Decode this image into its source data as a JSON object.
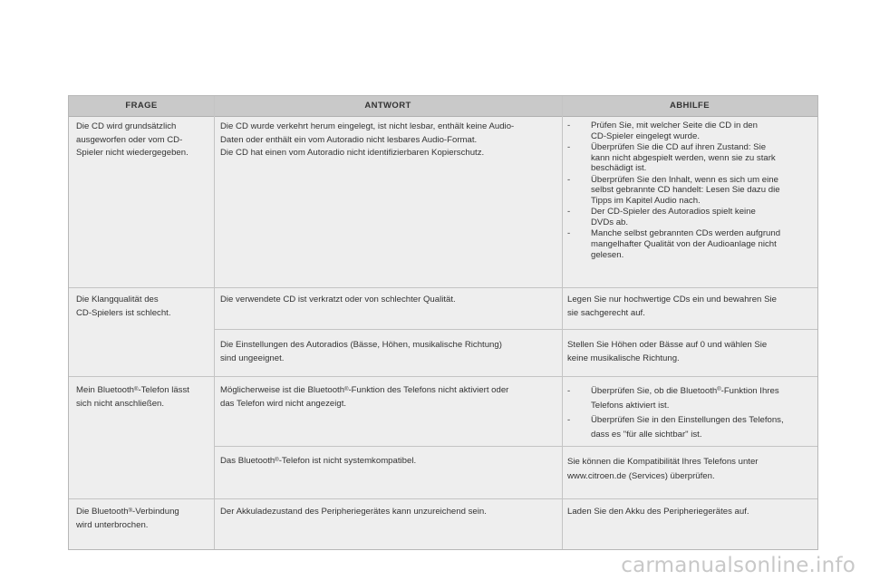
{
  "table": {
    "headers": [
      "FRAGE",
      "ANTWORT",
      "ABHILFE"
    ],
    "rows": [
      {
        "frage": [
          "Die CD wird grundsätzlich",
          "ausgeworfen oder vom CD-",
          "Spieler nicht wiedergegeben."
        ],
        "antwort": [
          "Die CD wurde verkehrt herum eingelegt, ist nicht lesbar, enthält keine Audio-",
          "Daten oder enthält ein vom Autoradio nicht lesbares Audio-Format.",
          "Die CD hat einen vom Autoradio nicht identifizierbaren Kopierschutz."
        ],
        "abhilfe": [
          {
            "dash": "-",
            "lines": [
              "Prüfen Sie, mit welcher Seite die CD in den",
              "CD-Spieler eingelegt wurde."
            ]
          },
          {
            "dash": "-",
            "lines": [
              "Überprüfen Sie die CD auf ihren Zustand: Sie",
              "kann nicht abgespielt werden, wenn sie zu stark",
              "beschädigt ist."
            ]
          },
          {
            "dash": "-",
            "lines": [
              "Überprüfen Sie den Inhalt, wenn es sich um eine",
              "selbst gebrannte CD handelt: Lesen Sie dazu die",
              "Tipps im Kapitel Audio nach."
            ]
          },
          {
            "dash": "-",
            "lines": [
              "Der CD-Spieler des Autoradios spielt keine",
              "DVDs ab."
            ]
          },
          {
            "dash": "-",
            "lines": [
              "Manche selbst gebrannten CDs werden aufgrund",
              "mangelhafter Qualität von der Audioanlage nicht",
              "gelesen."
            ]
          }
        ]
      },
      {
        "frage": [
          "Die Klangqualität des",
          "CD-Spielers ist schlecht."
        ],
        "antwort": [
          "Die verwendete CD ist verkratzt oder von schlechter Qualität."
        ],
        "abhilfe_text": [
          "Legen Sie nur hochwertige CDs ein und bewahren Sie",
          "sie sachgerecht auf."
        ]
      },
      {
        "antwort": [
          "Die Einstellungen des Autoradios (Bässe, Höhen, musikalische Richtung)",
          "sind ungeeignet."
        ],
        "abhilfe_text": [
          "Stellen Sie Höhen oder Bässe auf 0 und wählen Sie",
          "keine musikalische Richtung."
        ]
      },
      {
        "frage": [
          "Mein Bluetooth",
          "®",
          "-Telefon lässt",
          "sich nicht anschließen."
        ],
        "antwort": [
          "Möglicherweise ist die Bluetooth",
          "®",
          "-Funktion des Telefons nicht aktiviert oder",
          "das Telefon wird nicht angezeigt."
        ],
        "abhilfe": [
          {
            "dash": "-",
            "lines_sup": [
              "Überprüfen Sie, ob die Bluetooth",
              "®",
              "-Funktion Ihres"
            ],
            "lines": [
              "Telefons aktiviert ist."
            ]
          },
          {
            "dash": "-",
            "lines": [
              "Überprüfen Sie in den Einstellungen des Telefons,",
              "dass es \"für alle sichtbar\" ist."
            ]
          }
        ]
      },
      {
        "antwort": [
          "Das Bluetooth",
          "®",
          "-Telefon ist nicht systemkompatibel."
        ],
        "abhilfe_text": [
          "Sie können die Kompatibilität Ihres Telefons unter",
          "www.citroen.de (Services) überprüfen."
        ]
      },
      {
        "frage": [
          "Die Bluetooth",
          "®",
          "-Verbindung",
          "wird unterbrochen."
        ],
        "antwort": [
          "Der Akkuladezustand des Peripheriegerätes kann unzureichend sein."
        ],
        "abhilfe_text": [
          "Laden Sie den Akku des Peripheriegerätes auf."
        ]
      }
    ]
  },
  "watermark": "carmanualsonline.info"
}
